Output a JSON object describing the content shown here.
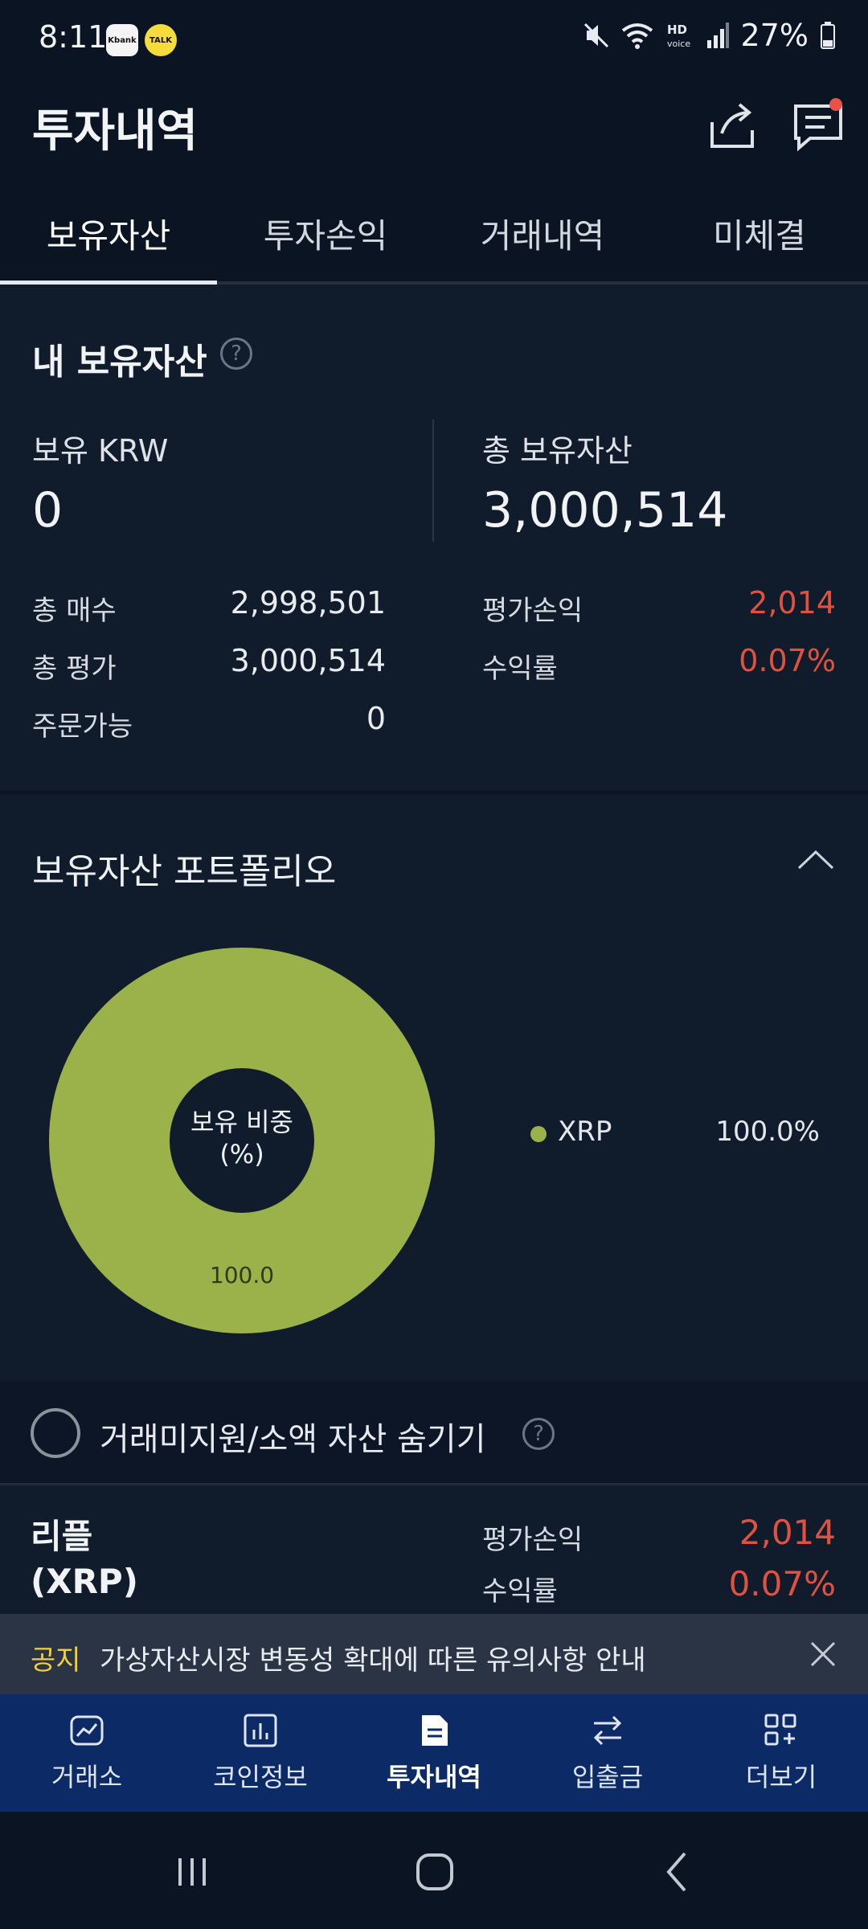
{
  "status": {
    "time": "8:11",
    "app_icons": [
      "Kbank",
      "TALK"
    ],
    "battery": "27%",
    "icons": [
      "mute-icon",
      "wifi-icon",
      "hd-voice-icon",
      "signal-icon",
      "battery-icon"
    ]
  },
  "header": {
    "title": "투자내역",
    "icons": [
      "share-icon",
      "message-icon"
    ],
    "notification_color": "#e8524a"
  },
  "tabs": [
    {
      "label": "보유자산",
      "active": true
    },
    {
      "label": "투자손익",
      "active": false
    },
    {
      "label": "거래내역",
      "active": false
    },
    {
      "label": "미체결",
      "active": false
    }
  ],
  "summary": {
    "title": "내 보유자산",
    "help": "?",
    "krw_label": "보유 KRW",
    "krw_value": "0",
    "total_label": "총 보유자산",
    "total_value": "3,000,514",
    "rows_left": [
      {
        "label": "총 매수",
        "value": "2,998,501"
      },
      {
        "label": "총 평가",
        "value": "3,000,514"
      },
      {
        "label": "주문가능",
        "value": "0"
      }
    ],
    "rows_right": [
      {
        "label": "평가손익",
        "value": "2,014"
      },
      {
        "label": "수익률",
        "value": "0.07%"
      }
    ],
    "profit_color": "#e0523f"
  },
  "portfolio": {
    "title": "보유자산 포트폴리오",
    "center_label_line1": "보유 비중",
    "center_label_line2": "(%)",
    "slice_label": "100.0",
    "legend": [
      {
        "name": "XRP",
        "pct": "100.0%",
        "color": "#9bb24a"
      }
    ]
  },
  "chart_data": {
    "type": "pie",
    "categories": [
      "XRP"
    ],
    "values": [
      100.0
    ],
    "title": "",
    "colors": [
      "#9bb24a"
    ]
  },
  "hide_small": {
    "label": "거래미지원/소액 자산 숨기기",
    "checked": false
  },
  "asset": {
    "name_line1": "리플",
    "name_line2": "(XRP)",
    "pl_label": "평가손익",
    "pl_value": "2,014",
    "rate_label": "수익률",
    "rate_value": "0.07%"
  },
  "notice": {
    "tag": "공지",
    "text": "가상자산시장 변동성 확대에 따른 유의사항 안내"
  },
  "bottom_nav": [
    {
      "label": "거래소",
      "icon": "chart-icon",
      "active": false
    },
    {
      "label": "코인정보",
      "icon": "bar-chart-icon",
      "active": false
    },
    {
      "label": "투자내역",
      "icon": "document-icon",
      "active": true
    },
    {
      "label": "입출금",
      "icon": "transfer-icon",
      "active": false
    },
    {
      "label": "더보기",
      "icon": "more-grid-icon",
      "active": false
    }
  ],
  "system_nav": [
    "recent-apps-icon",
    "home-icon",
    "back-icon"
  ]
}
